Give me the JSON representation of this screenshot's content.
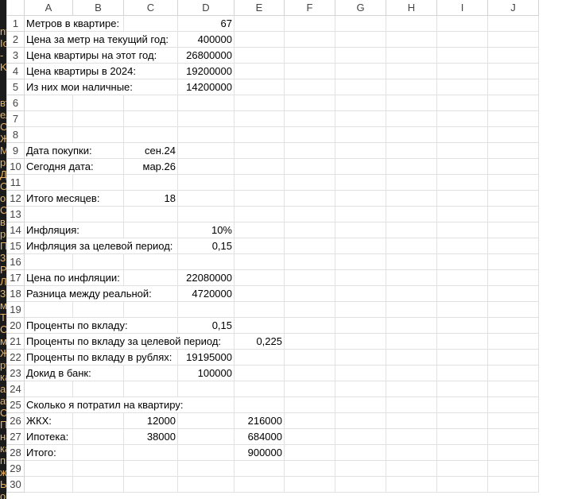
{
  "left_strip": [
    "nt",
    "Io",
    "-",
    "K",
    "",
    "",
    "вт",
    "ел",
    "Сб",
    "Ж",
    "М",
    "р",
    "Д",
    "О",
    "о",
    "СК",
    "в",
    "р",
    "П",
    "3",
    "Р",
    "Л",
    "3",
    "м",
    "Т",
    "С",
    "м",
    "Ж",
    "ру",
    "ка",
    "ар",
    "ау",
    "С",
    "П",
    "на",
    "ка",
    "пь",
    "ж",
    "Ы",
    "о"
  ],
  "columns": [
    "A",
    "B",
    "C",
    "D",
    "E",
    "F",
    "G",
    "H",
    "I",
    "J"
  ],
  "rows": [
    {
      "n": "1",
      "a": "Метров в квартире:",
      "d": "67"
    },
    {
      "n": "2",
      "a": "Цена за метр на текущий год:",
      "d": "400000"
    },
    {
      "n": "3",
      "a": "Цена квартиры на этот год:",
      "d": "26800000"
    },
    {
      "n": "4",
      "a": "Цена квартиры в 2024:",
      "d": "19200000"
    },
    {
      "n": "5",
      "a": "Из них мои наличные:",
      "d": "14200000"
    },
    {
      "n": "6"
    },
    {
      "n": "7"
    },
    {
      "n": "8"
    },
    {
      "n": "9",
      "a": "Дата покупки:",
      "c": "сен.24"
    },
    {
      "n": "10",
      "a": "Сегодня дата:",
      "c": "мар.26"
    },
    {
      "n": "11"
    },
    {
      "n": "12",
      "a": "Итого месяцев:",
      "c": "18"
    },
    {
      "n": "13"
    },
    {
      "n": "14",
      "a": "Инфляция:",
      "d": "10%"
    },
    {
      "n": "15",
      "a": "Инфляция за целевой период:",
      "d": "0,15"
    },
    {
      "n": "16"
    },
    {
      "n": "17",
      "a": "Цена по инфляции:",
      "d": "22080000"
    },
    {
      "n": "18",
      "a": "Разница между реальной:",
      "d": "4720000"
    },
    {
      "n": "19"
    },
    {
      "n": "20",
      "a": "Проценты по вкладу:",
      "d": "0,15"
    },
    {
      "n": "21",
      "a": "Проценты по вкладу за целевой период:",
      "e": "0,225"
    },
    {
      "n": "22",
      "a": "Проценты по вкладу в рублях:",
      "d": "19195000"
    },
    {
      "n": "23",
      "a": "Докид в банк:",
      "d": "100000"
    },
    {
      "n": "24"
    },
    {
      "n": "25",
      "a": "Сколько я потратил на квартиру:"
    },
    {
      "n": "26",
      "a": "ЖКХ:",
      "c": "12000",
      "e": "216000"
    },
    {
      "n": "27",
      "a": "Ипотека:",
      "c": "38000",
      "e": "684000"
    },
    {
      "n": "28",
      "a": "Итого:",
      "e": "900000"
    },
    {
      "n": "29"
    },
    {
      "n": "30"
    }
  ]
}
